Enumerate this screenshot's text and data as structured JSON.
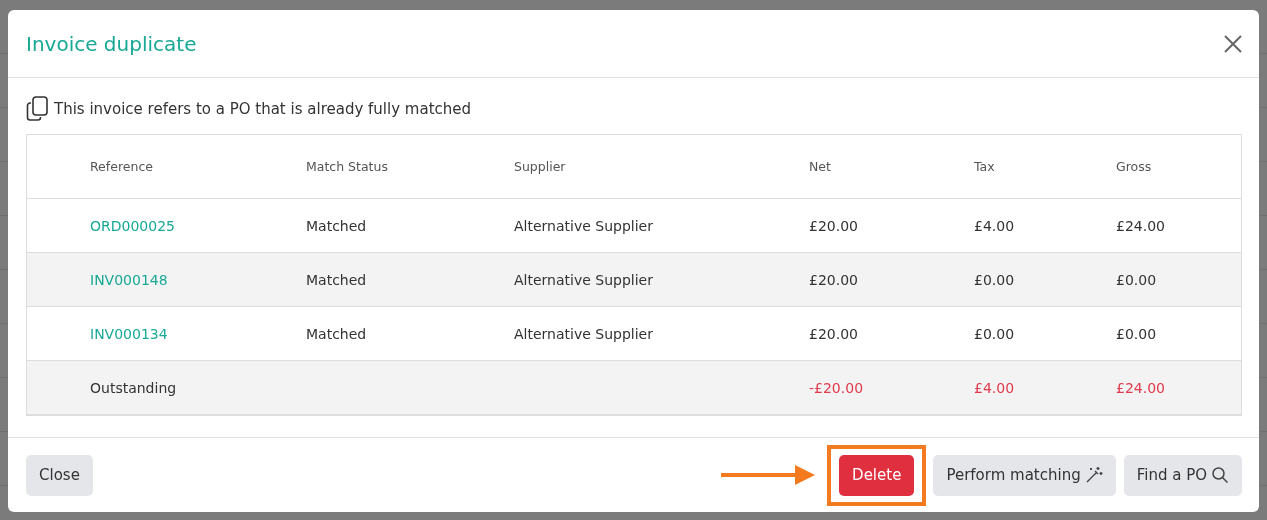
{
  "dialog": {
    "title": "Invoice duplicate",
    "notice": "This invoice refers to a PO that is already fully matched"
  },
  "table": {
    "columns": [
      "Reference",
      "Match Status",
      "Supplier",
      "Net",
      "Tax",
      "Gross"
    ],
    "rows": [
      {
        "kind": "item",
        "cells": [
          "ORD000025",
          "Matched",
          "Alternative Supplier",
          "£20.00",
          "£4.00",
          "£24.00"
        ]
      },
      {
        "kind": "item",
        "cells": [
          "INV000148",
          "Matched",
          "Alternative Supplier",
          "£20.00",
          "£0.00",
          "£0.00"
        ]
      },
      {
        "kind": "item",
        "cells": [
          "INV000134",
          "Matched",
          "Alternative Supplier",
          "£20.00",
          "£0.00",
          "£0.00"
        ]
      },
      {
        "kind": "total",
        "cells": [
          "Outstanding",
          "",
          "",
          "-£20.00",
          "£4.00",
          "£24.00"
        ]
      }
    ]
  },
  "footer": {
    "left": [
      {
        "label": "Close",
        "kind": "plain",
        "highlighted": false
      }
    ],
    "right": [
      {
        "label": "Delete",
        "kind": "danger",
        "highlighted": true
      },
      {
        "label": "Perform matching",
        "kind": "wand",
        "highlighted": false
      },
      {
        "label": "Find a PO",
        "kind": "search",
        "highlighted": false
      }
    ]
  }
}
